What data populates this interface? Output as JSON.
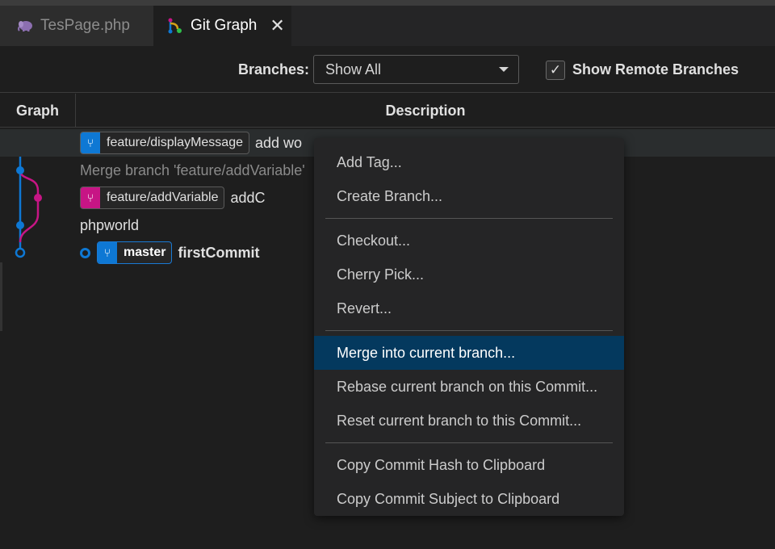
{
  "tabs": [
    {
      "label": "TesPage.php",
      "icon": "elephant-icon",
      "active": false
    },
    {
      "label": "Git Graph",
      "icon": "git-graph-icon",
      "active": true,
      "close": "✕"
    }
  ],
  "controls": {
    "branches_label": "Branches:",
    "branches_value": "Show All",
    "show_remote_label": "Show Remote Branches",
    "show_remote_checked": true
  },
  "table": {
    "col_graph": "Graph",
    "col_description": "Description"
  },
  "rows": [
    {
      "ref": "feature/displayMessage",
      "ref_color": "#0e78d4",
      "message": "add wo"
    },
    {
      "ref": "",
      "message": "Merge branch 'feature/addVariable'",
      "dim": true
    },
    {
      "ref": "feature/addVariable",
      "ref_color": "#c71585",
      "message": "addC"
    },
    {
      "ref": "",
      "message": "phpworld"
    },
    {
      "ref": "master",
      "ref_color": "#0e78d4",
      "message": "firstCommit",
      "head": true
    }
  ],
  "menu": {
    "groups": [
      [
        "Add Tag...",
        "Create Branch..."
      ],
      [
        "Checkout...",
        "Cherry Pick...",
        "Revert..."
      ],
      [
        "Merge into current branch...",
        "Rebase current branch on this Commit...",
        "Reset current branch to this Commit..."
      ],
      [
        "Copy Commit Hash to Clipboard",
        "Copy Commit Subject to Clipboard"
      ]
    ],
    "active_item": "Merge into current branch..."
  },
  "colors": {
    "branch_blue": "#0e78d4",
    "branch_pink": "#c71585",
    "menu_active": "#04395e",
    "background": "#1e1e1e"
  }
}
